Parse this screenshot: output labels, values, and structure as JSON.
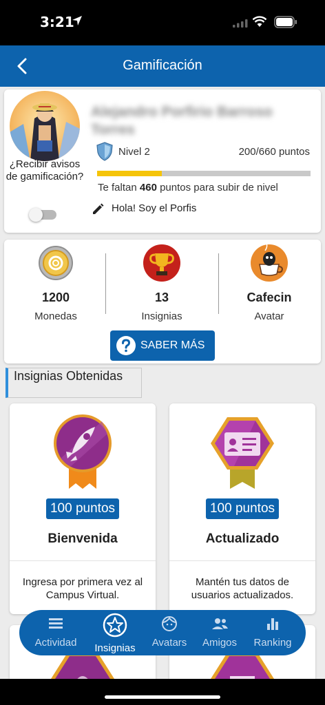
{
  "status_bar": {
    "time": "3:21"
  },
  "header": {
    "title": "Gamificación"
  },
  "profile": {
    "name": "Alejandro Porfirio Barroso Torres",
    "notify_label": "¿Recibir avisos de gamificación?",
    "notify_enabled": false,
    "level": "Nivel 2",
    "points": "200/660 puntos",
    "progress_fraction": 0.303,
    "remaining_prefix": "Te faltan",
    "remaining_value": "460",
    "remaining_suffix": "puntos para subir de nivel",
    "status_message": "Hola! Soy el Porfis"
  },
  "stats": [
    {
      "value": "1200",
      "label": "Monedas",
      "icon": "coin-icon"
    },
    {
      "value": "13",
      "label": "Insignias",
      "icon": "trophy-icon"
    },
    {
      "value": "Cafecin",
      "label": "Avatar",
      "icon": "coffee-avatar-icon"
    }
  ],
  "learn_more": {
    "label": "SABER MÁS"
  },
  "section": {
    "title": "Insignias Obtenidas"
  },
  "badges": [
    {
      "points": "100 puntos",
      "name": "Bienvenida",
      "description": "Ingresa por primera vez al Campus Virtual.",
      "icon": "rocket-badge-icon"
    },
    {
      "points": "100 puntos",
      "name": "Actualizado",
      "description": "Mantén tus datos de usuarios actualizados.",
      "icon": "id-card-badge-icon"
    }
  ],
  "nav": {
    "items": [
      {
        "label": "Actividad",
        "icon": "list-icon",
        "active": false
      },
      {
        "label": "Insignias",
        "icon": "star-badge-icon",
        "active": true
      },
      {
        "label": "Avatars",
        "icon": "face-icon",
        "active": false
      },
      {
        "label": "Amigos",
        "icon": "people-icon",
        "active": false
      },
      {
        "label": "Ranking",
        "icon": "bar-chart-icon",
        "active": false
      }
    ]
  },
  "colors": {
    "primary": "#0d63ad",
    "progress": "#f5c40a",
    "accent": "#2f8fdc"
  }
}
